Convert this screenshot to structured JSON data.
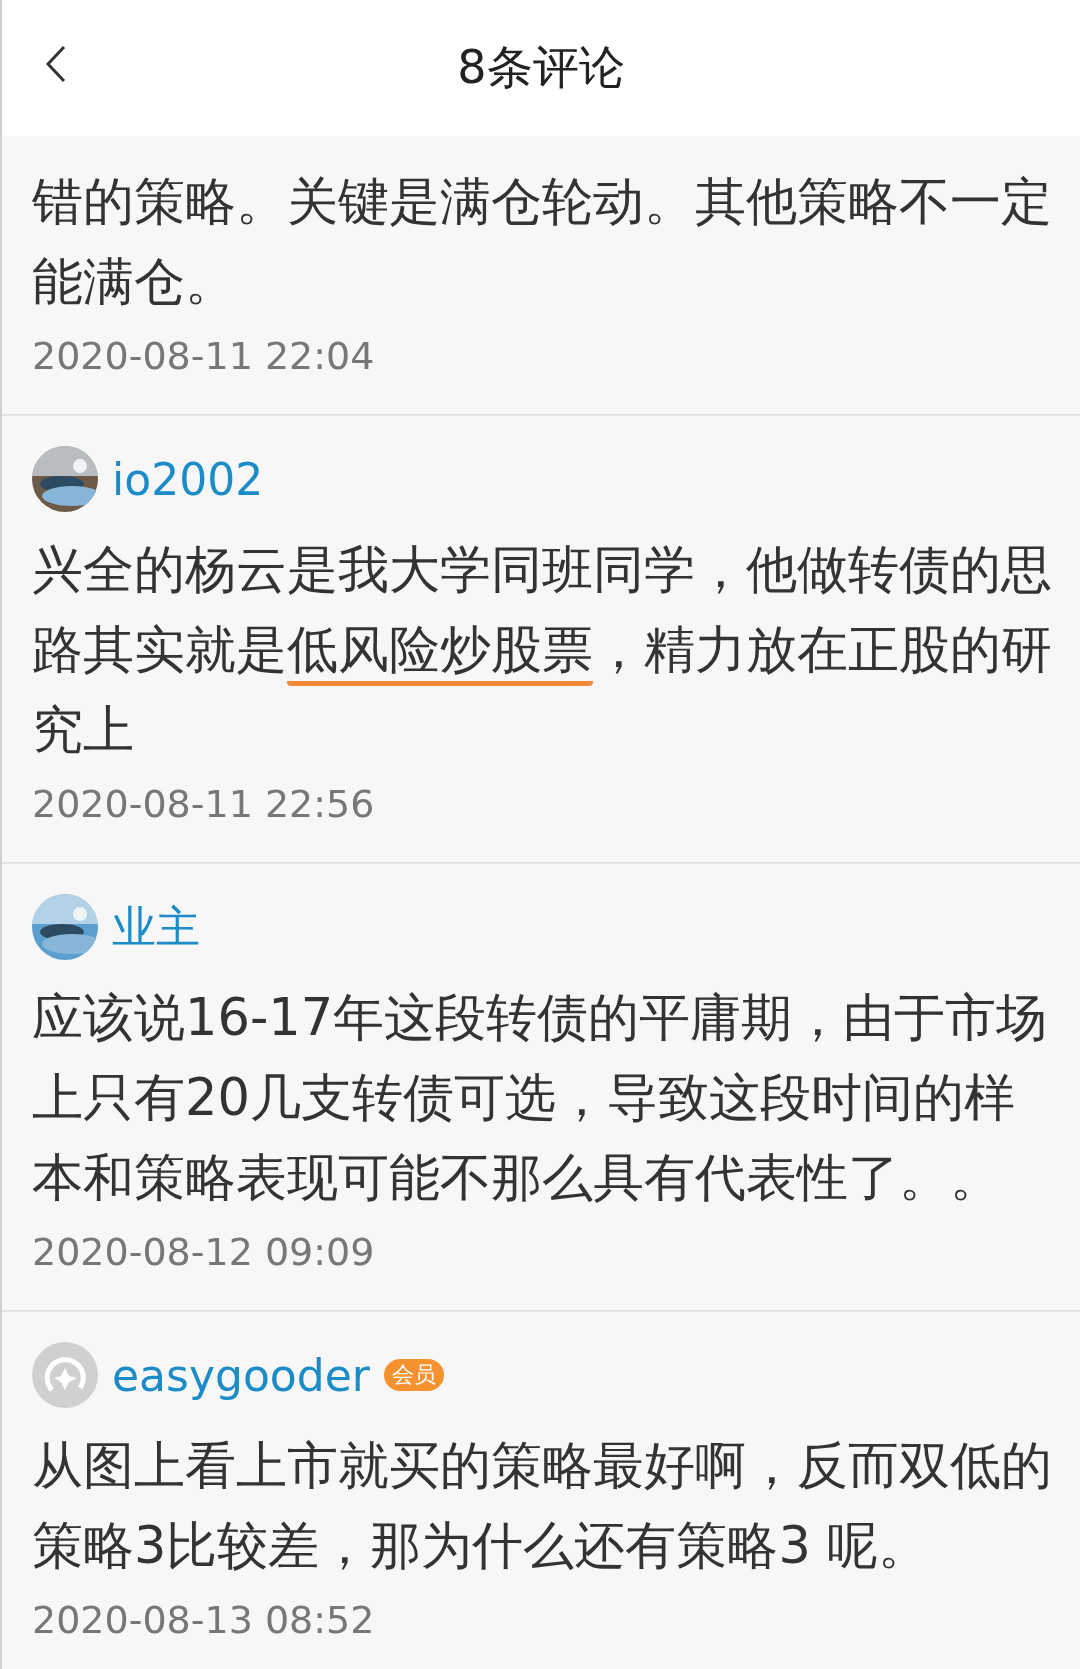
{
  "header": {
    "title": "8条评论"
  },
  "comments": [
    {
      "text_parts": [
        {
          "text": "错的策略。关键是满仓轮动。其他策略不一定能满仓。",
          "underlined": false
        }
      ],
      "time": "2020-08-11 22:04"
    },
    {
      "author": {
        "name": "io2002"
      },
      "text_parts": [
        {
          "text": "兴全的杨云是我大学同班同学，他做转债的思路其实就是",
          "underlined": false
        },
        {
          "text": "低风险炒股票",
          "underlined": true
        },
        {
          "text": "，精力放在正股的研究上",
          "underlined": false
        }
      ],
      "time": "2020-08-11 22:56"
    },
    {
      "author": {
        "name": "业主"
      },
      "text_parts": [
        {
          "text": "应该说16-17年这段转债的平庸期，由于市场上只有20几支转债可选，导致这段时间的样本和策略表现可能不那么具有代表性了。。",
          "underlined": false
        }
      ],
      "time": "2020-08-12 09:09"
    },
    {
      "author": {
        "name": "easygooder",
        "avatar": {
          "kind": "default"
        },
        "badge": "会员"
      },
      "text_parts": [
        {
          "text": "从图上看上市就买的策略最好啊，反而双低的策略3比较差，那为什么还有策略3 呢。",
          "underlined": false
        }
      ],
      "time": "2020-08-13 08:52"
    }
  ]
}
